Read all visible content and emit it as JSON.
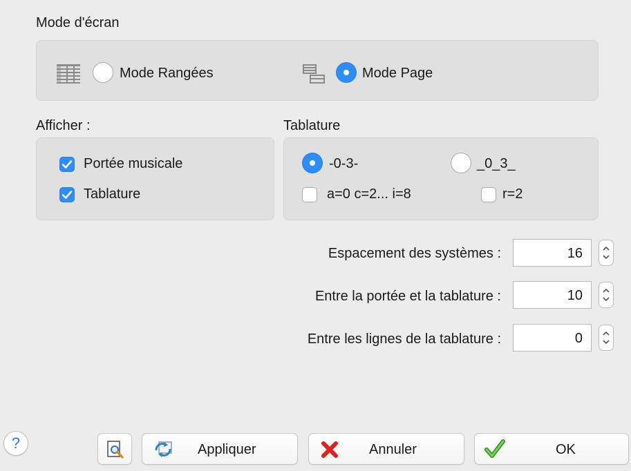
{
  "screen_mode": {
    "title": "Mode d'écran",
    "rows_label": "Mode Rangées",
    "rows_selected": false,
    "rows_icon": "table-rows-icon",
    "page_label": "Mode Page",
    "page_selected": true,
    "page_icon": "page-layout-icon"
  },
  "display": {
    "title": "Afficher :",
    "staff_label": "Portée musicale",
    "staff_checked": true,
    "tab_label": "Tablature",
    "tab_checked": true
  },
  "tablature": {
    "title": "Tablature",
    "style_dash_label": "-0-3-",
    "style_dash_selected": true,
    "style_underscore_label": "_0_3_",
    "style_underscore_selected": false,
    "letters_label": "a=0 c=2... i=8",
    "letters_checked": false,
    "r2_label": "r=2",
    "r2_checked": false
  },
  "spacing": {
    "systems_label": "Espacement des systèmes :",
    "systems_value": "16",
    "staff_tab_label": "Entre la portée et la tablature :",
    "staff_tab_value": "10",
    "tab_lines_label": "Entre les lignes de la tablature :",
    "tab_lines_value": "0"
  },
  "footer": {
    "help_label": "?",
    "preview_icon": "print-preview-icon",
    "apply_label": "Appliquer",
    "apply_icon": "refresh-icon",
    "cancel_label": "Annuler",
    "cancel_icon": "red-x-icon",
    "ok_label": "OK",
    "ok_icon": "green-check-icon"
  },
  "colors": {
    "accent": "#2f8ef6",
    "background": "#ececec",
    "group_box": "#e0e0e0",
    "cancel_red": "#d9241f",
    "ok_green": "#4fbf3a"
  }
}
